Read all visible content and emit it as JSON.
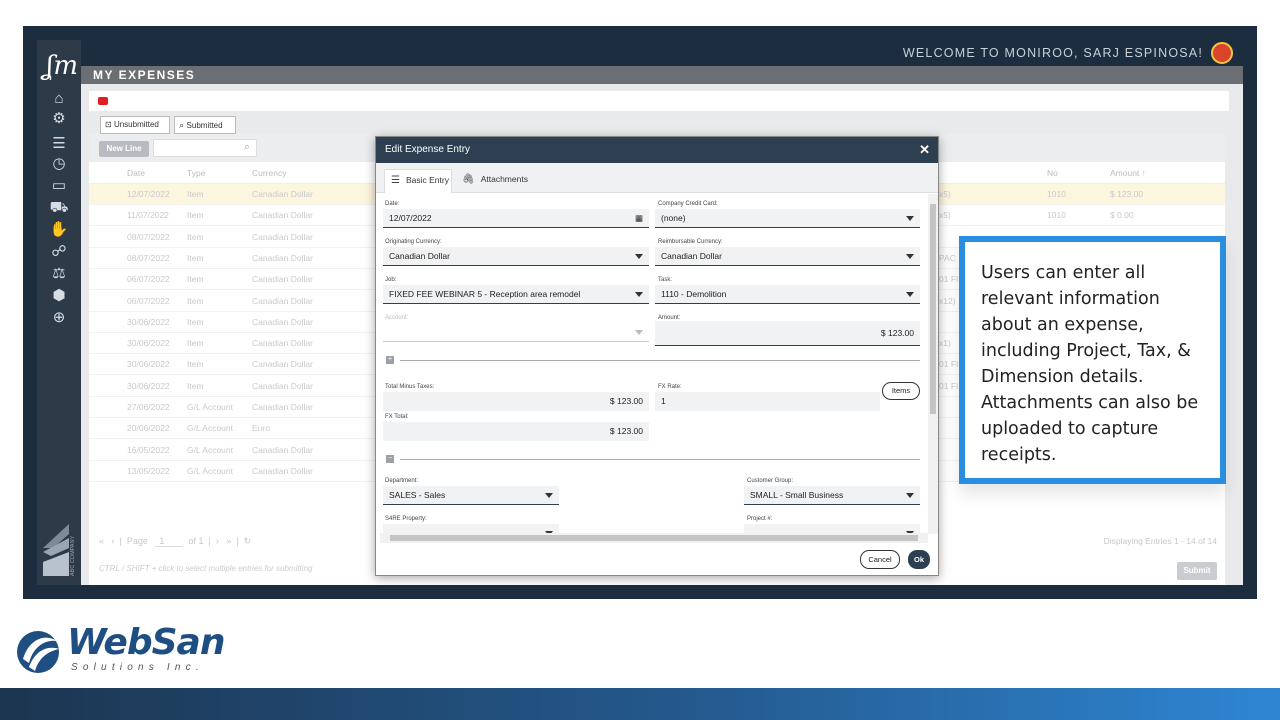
{
  "app": {
    "welcome": "WELCOME TO MONIROO, SARJ ESPINOSA!",
    "page_title": "MY EXPENSES",
    "sidebar_icons": [
      "home-icon",
      "settings-icon",
      "database-icon",
      "clock-icon",
      "card-icon",
      "cart-icon",
      "thumbs-up-icon",
      "users-icon",
      "scale-icon",
      "shield-icon",
      "zoom-icon"
    ],
    "company_label": "ABC COMPANY"
  },
  "tabs": [
    "Unsubmitted",
    "Submitted"
  ],
  "toolbar": {
    "new_line": "New Line"
  },
  "grid": {
    "headers": {
      "date": "Date",
      "type": "Type",
      "currency": "Currency",
      "no": "No",
      "amount": "Amount ↑"
    },
    "rows": [
      {
        "date": "12/07/2022",
        "type": "Item",
        "currency": "Canadian Dollar",
        "right": "x5)",
        "no": "1010",
        "amount": "$    123.00"
      },
      {
        "date": "11/07/2022",
        "type": "Item",
        "currency": "Canadian Dollar",
        "right": "x5)",
        "no": "1010",
        "amount": "$      0.00"
      },
      {
        "date": "08/07/2022",
        "type": "Item",
        "currency": "Canadian Dollar",
        "right": "",
        "no": "",
        "amount": ""
      },
      {
        "date": "08/07/2022",
        "type": "Item",
        "currency": "Canadian Dollar",
        "right": "PAC",
        "no": "",
        "amount": ""
      },
      {
        "date": "06/07/2022",
        "type": "Item",
        "currency": "Canadian Dollar",
        "right": "01 FI",
        "no": "",
        "amount": ""
      },
      {
        "date": "06/07/2022",
        "type": "Item",
        "currency": "Canadian Dollar",
        "right": "x12)",
        "no": "",
        "amount": ""
      },
      {
        "date": "30/06/2022",
        "type": "Item",
        "currency": "Canadian Dollar",
        "right": "",
        "no": "",
        "amount": ""
      },
      {
        "date": "30/06/2022",
        "type": "Item",
        "currency": "Canadian Dollar",
        "right": "x1)",
        "no": "",
        "amount": ""
      },
      {
        "date": "30/06/2022",
        "type": "Item",
        "currency": "Canadian Dollar",
        "right": "01 FI",
        "no": "",
        "amount": ""
      },
      {
        "date": "30/06/2022",
        "type": "Item",
        "currency": "Canadian Dollar",
        "right": "01 FI",
        "no": "",
        "amount": ""
      },
      {
        "date": "27/06/2022",
        "type": "G/L Account",
        "currency": "Canadian Dollar",
        "right": "",
        "no": "",
        "amount": ""
      },
      {
        "date": "20/06/2022",
        "type": "G/L Account",
        "currency": "Euro",
        "right": "",
        "no": "",
        "amount": ""
      },
      {
        "date": "16/05/2022",
        "type": "G/L Account",
        "currency": "Canadian Dollar",
        "right": "",
        "no": "",
        "amount": ""
      },
      {
        "date": "13/05/2022",
        "type": "G/L Account",
        "currency": "Canadian Dollar",
        "right": "",
        "no": "",
        "amount": ""
      }
    ],
    "pager": {
      "page_label": "Page",
      "page_value": "1",
      "of_label": "of 1"
    },
    "displaying": "Displaying Entries 1 - 14 of 14",
    "hint": "CTRL / SHIFT + click to select multiple entries for submitting",
    "submit": "Submit"
  },
  "modal": {
    "title": "Edit Expense Entry",
    "tab_basic": "Basic Entry",
    "tab_attachments": "Attachments",
    "fields": {
      "date_label": "Date:",
      "date_value": "12/07/2022",
      "ccard_label": "Company Credit Card:",
      "ccard_value": "(none)",
      "orig_cur_label": "Originating Currency:",
      "orig_cur_value": "Canadian Dollar",
      "reimb_cur_label": "Reimbursable Currency:",
      "reimb_cur_value": "Canadian Dollar",
      "job_label": "Job:",
      "job_value": "FIXED FEE WEBINAR 5 - Reception area remodel",
      "task_label": "Task:",
      "task_value": "1110 - Demolition",
      "account_label": "Account:",
      "account_value": "",
      "amount_label": "Amount:",
      "amount_value": "$ 123.00",
      "total_minus_label": "Total Minus Taxes:",
      "total_minus_value": "$ 123.00",
      "fx_rate_label": "FX Rate:",
      "fx_rate_value": "1",
      "fx_total_label": "FX Total:",
      "fx_total_value": "$ 123.00",
      "dept_label": "Department:",
      "dept_value": "SALES - Sales",
      "cust_group_label": "Customer Group:",
      "cust_group_value": "SMALL - Small Business",
      "property_label": "S4RE Property:",
      "project_label": "Project #:"
    },
    "items_button": "Items",
    "cancel": "Cancel",
    "ok": "Ok"
  },
  "callout": {
    "text": "Users can enter all relevant information about an expense, including Project, Tax, & Dimension details. Attachments can also be uploaded to capture receipts."
  },
  "branding": {
    "logo_word": "WebSan",
    "logo_sub": "Solutions Inc.",
    "colors": {
      "accent_blue": "#2a8ee0",
      "dark_navy": "#1c2d3f",
      "modal_header": "#2e3f52"
    }
  }
}
